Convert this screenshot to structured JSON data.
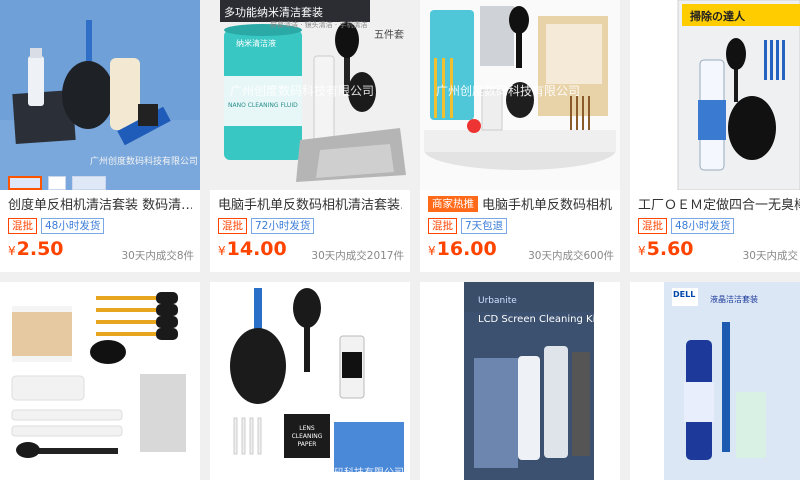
{
  "products": [
    {
      "title": "创度单反相机清洁套装 数码清…",
      "tags": [
        {
          "text": "混批",
          "style": "red"
        },
        {
          "text": "48小时发货",
          "style": "blue"
        }
      ],
      "price_currency": "¥",
      "price": "2.50",
      "sold": "30天内成交8件",
      "watermark": "广州创度数码科技有限公司"
    },
    {
      "title": "电脑手机单反数码相机清洁套装…",
      "tags": [
        {
          "text": "混批",
          "style": "red"
        },
        {
          "text": "72小时发货",
          "style": "blue"
        }
      ],
      "price_currency": "¥",
      "price": "14.00",
      "sold": "30天内成交2017件",
      "watermark": "广州创度数码科技有限公司",
      "image_text": {
        "banner": "多功能纳米清洁套装",
        "sub": "五件套",
        "caption": "屏幕清洁 · 镜头清洁 · 手机清洁",
        "bottle_label": "纳米清洁液",
        "bottle_eng": "NANO CLEANING FLUID"
      }
    },
    {
      "title": "电脑手机单反数码相机…",
      "tags": [
        {
          "text": "商家热推",
          "style": "hot"
        },
        {
          "text": "混批",
          "style": "red"
        },
        {
          "text": "7天包退",
          "style": "blue"
        }
      ],
      "price_currency": "¥",
      "price": "16.00",
      "sold": "30天内成交600件",
      "watermark": "广州创度数码科技有限公司"
    },
    {
      "title": "工厂ＯＥＭ定做四合一无臭棒",
      "tags": [
        {
          "text": "混批",
          "style": "red"
        },
        {
          "text": "48小时发货",
          "style": "blue"
        }
      ],
      "price_currency": "¥",
      "price": "5.60",
      "sold": "30天内成交",
      "image_text": {
        "header": "掃除の達人"
      }
    },
    {
      "watermark": ""
    },
    {
      "watermark": "广州创度数码科技有限公司",
      "image_text": {
        "lens_paper": "LENS CLEANING PAPER"
      }
    },
    {
      "image_text": {
        "kit": "LCD Screen Cleaning Kit",
        "brand": "Urbanite"
      }
    },
    {
      "image_text": {
        "brand": "DELL",
        "cn": "液晶洁洁套装"
      }
    }
  ]
}
